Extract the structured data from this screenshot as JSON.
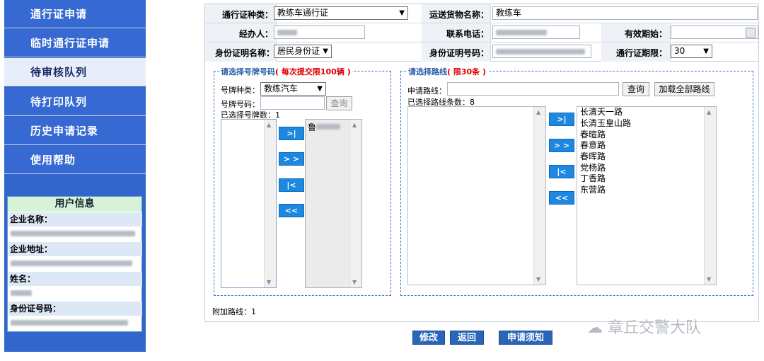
{
  "sidebar": {
    "items": [
      {
        "label": "通行证申请",
        "active": false
      },
      {
        "label": "临时通行证申请",
        "active": false
      },
      {
        "label": "待审核队列",
        "active": true
      },
      {
        "label": "待打印队列",
        "active": false
      },
      {
        "label": "历史申请记录",
        "active": false
      },
      {
        "label": "使用帮助",
        "active": false
      }
    ],
    "user_info": {
      "title": "用户信息",
      "company_label": "企业名称：",
      "address_label": "企业地址：",
      "name_label": "姓名：",
      "id_label": "身份证号码："
    }
  },
  "form": {
    "pass_type_label": "通行证种类：",
    "pass_type_value": "教练车通行证",
    "cargo_label": "运送货物名称：",
    "cargo_value": "教练车",
    "operator_label": "经办人：",
    "phone_label": "联系电话：",
    "start_date_label": "有效期始：",
    "id_doc_label": "身份证明名称：",
    "id_doc_value": "居民身份证",
    "id_number_label": "身份证明号码：",
    "period_label": "通行证期限：",
    "period_value": "30"
  },
  "plate_section": {
    "legend": "请选择号牌号码",
    "legend_note": "( 每次提交限100辆 )",
    "plate_type_label": "号牌种类：",
    "plate_type_value": "教练汽车",
    "plate_number_label": "号牌号码：",
    "query_label": "查询",
    "selected_count_label": "已选择号牌数：1",
    "selected_plate_prefix": "鲁"
  },
  "route_section": {
    "legend": "请选择路线",
    "legend_note": "( 限30条 )",
    "apply_route_label": "申请路线：",
    "query_label": "查询",
    "load_all_label": "加载全部路线",
    "selected_count_label": "已选择路线条数：8",
    "selected_routes": [
      "长清天一路",
      "长清玉皇山路",
      "春暄路",
      "春意路",
      "春晖路",
      "党杨路",
      "丁香路",
      "东营路"
    ]
  },
  "move_buttons": {
    "one": ">|",
    "all": "> >",
    "back_one": "|<",
    "back_all": "<<"
  },
  "extra_route_label": "附加路线：1",
  "actions": {
    "modify": "修改",
    "back": "返回",
    "notice": "申请须知"
  },
  "watermark": "章丘交警大队",
  "colors": {
    "sidebar": "#3366cc",
    "button_blue": "#1e88e0",
    "legend_blue": "#2b5da8",
    "legend_red": "#e00000"
  }
}
